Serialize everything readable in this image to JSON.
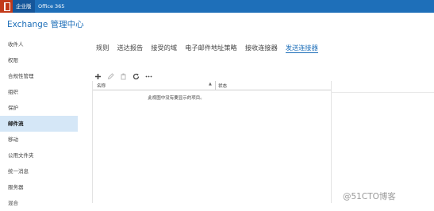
{
  "topbar": {
    "active_tab": "企业版",
    "office_link": "Office 365"
  },
  "app": {
    "title": "Exchange 管理中心"
  },
  "sidebar": {
    "items": [
      {
        "label": "收件人"
      },
      {
        "label": "权限"
      },
      {
        "label": "合规性管理"
      },
      {
        "label": "组织"
      },
      {
        "label": "保护"
      },
      {
        "label": "邮件流",
        "selected": true
      },
      {
        "label": "移动"
      },
      {
        "label": "公用文件夹"
      },
      {
        "label": "统一消息"
      },
      {
        "label": "服务器"
      },
      {
        "label": "混合"
      }
    ]
  },
  "tabs": [
    {
      "label": "规则"
    },
    {
      "label": "送达报告"
    },
    {
      "label": "接受的域"
    },
    {
      "label": "电子邮件地址策略"
    },
    {
      "label": "接收连接器"
    },
    {
      "label": "发送连接器",
      "active": true
    }
  ],
  "toolbar": {
    "icons": [
      "add-icon",
      "edit-icon",
      "delete-icon",
      "refresh-icon",
      "more-icon"
    ]
  },
  "grid": {
    "columns": [
      {
        "label": "名称"
      },
      {
        "label": "状态"
      }
    ],
    "empty_message": "此视图中没有要显示的项目。"
  },
  "watermark": "@51CTO博客",
  "colors": {
    "topbar": "#1e6fb9",
    "accent": "#1e6fb9",
    "selected_nav_bg": "#d5e7f7",
    "office_logo": "#c23a1a"
  }
}
